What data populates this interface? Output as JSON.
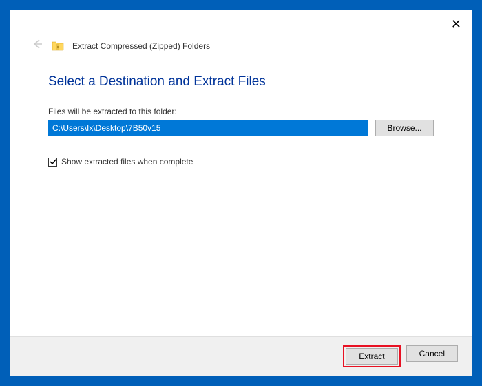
{
  "window": {
    "title": "Extract Compressed (Zipped) Folders"
  },
  "content": {
    "heading": "Select a Destination and Extract Files",
    "path_label": "Files will be extracted to this folder:",
    "path_value": "C:\\Users\\Ix\\Desktop\\7B50v15",
    "browse_label": "Browse...",
    "checkbox_label": "Show extracted files when complete",
    "checkbox_checked": true
  },
  "footer": {
    "extract_label": "Extract",
    "cancel_label": "Cancel"
  }
}
